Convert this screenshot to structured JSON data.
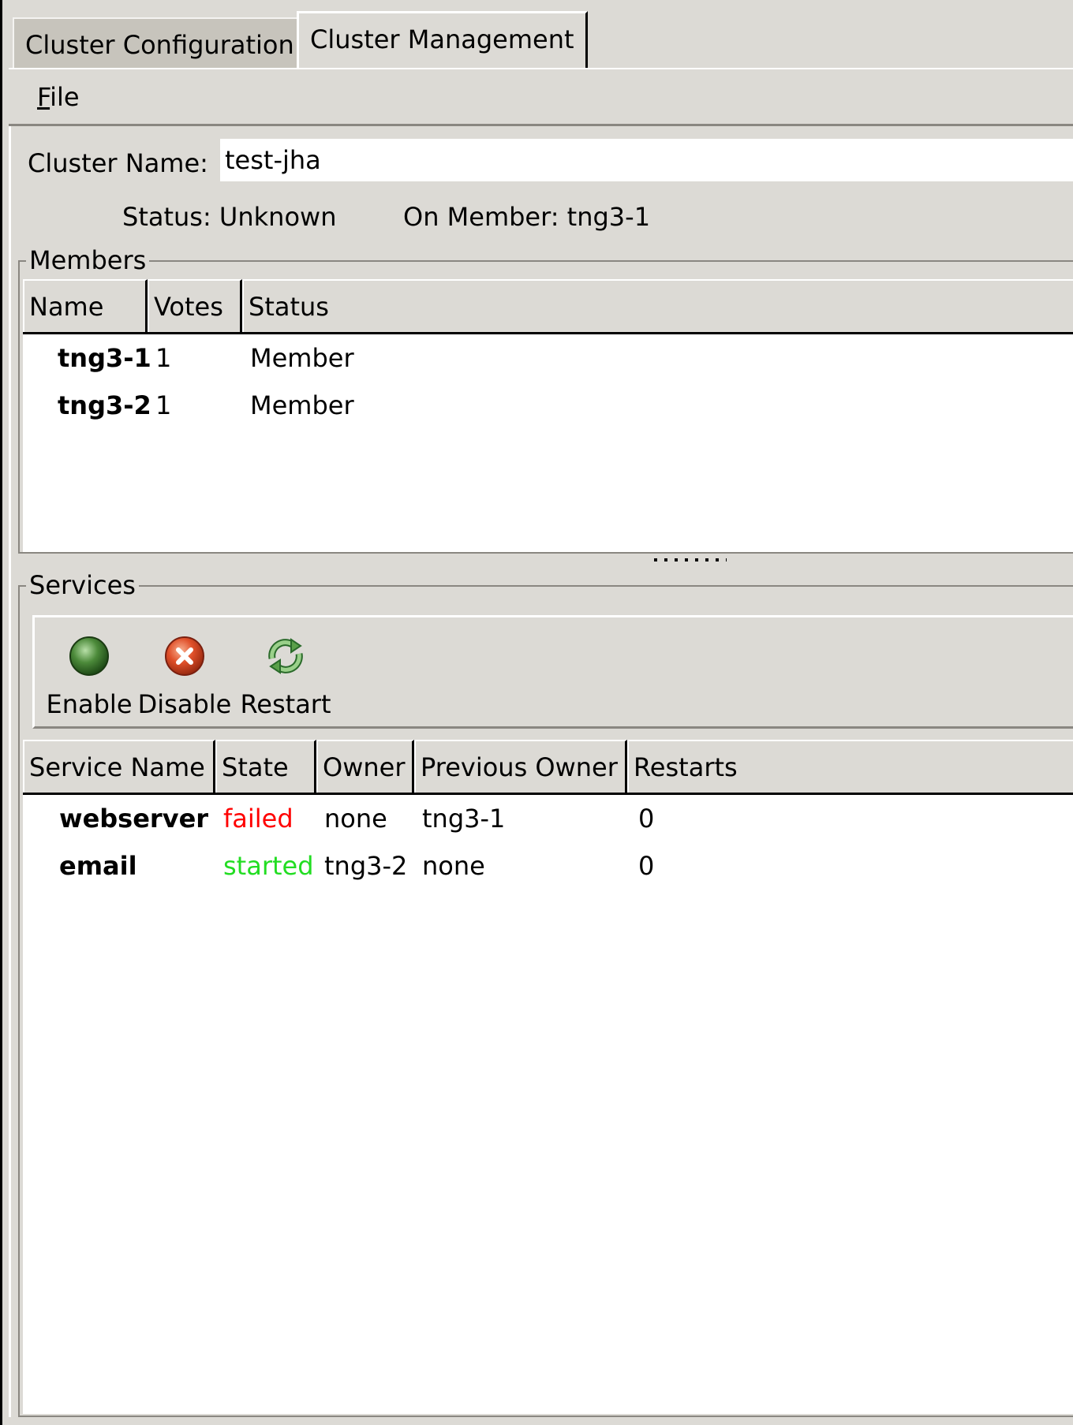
{
  "tabs": [
    {
      "label": "Cluster Configuration",
      "active": false
    },
    {
      "label": "Cluster Management",
      "active": true
    }
  ],
  "menu": {
    "file_underlined": "F",
    "file_rest": "ile"
  },
  "cluster": {
    "name_label": "Cluster Name:",
    "name_value": "test-jha",
    "status_text": "Status: Unknown",
    "on_member_text": "On Member: tng3-1"
  },
  "members": {
    "title": "Members",
    "columns": [
      "Name",
      "Votes",
      "Status"
    ],
    "rows": [
      {
        "name": "tng3-1",
        "votes": "1",
        "status": "Member"
      },
      {
        "name": "tng3-2",
        "votes": "1",
        "status": "Member"
      }
    ]
  },
  "services": {
    "title": "Services",
    "toolbar": [
      {
        "label": "Enable",
        "icon": "green-circle-icon"
      },
      {
        "label": "Disable",
        "icon": "red-x-circle-icon"
      },
      {
        "label": "Restart",
        "icon": "restart-arrows-icon"
      }
    ],
    "columns": [
      "Service Name",
      "State",
      "Owner",
      "Previous Owner",
      "Restarts"
    ],
    "rows": [
      {
        "name": "webserver",
        "state": "failed",
        "owner": "none",
        "previous_owner": "tng3-1",
        "restarts": "0"
      },
      {
        "name": "email",
        "state": "started",
        "owner": "tng3-2",
        "previous_owner": "none",
        "restarts": "0"
      }
    ],
    "state_colors": {
      "failed": "#ff0000",
      "started": "#22dd22"
    }
  }
}
